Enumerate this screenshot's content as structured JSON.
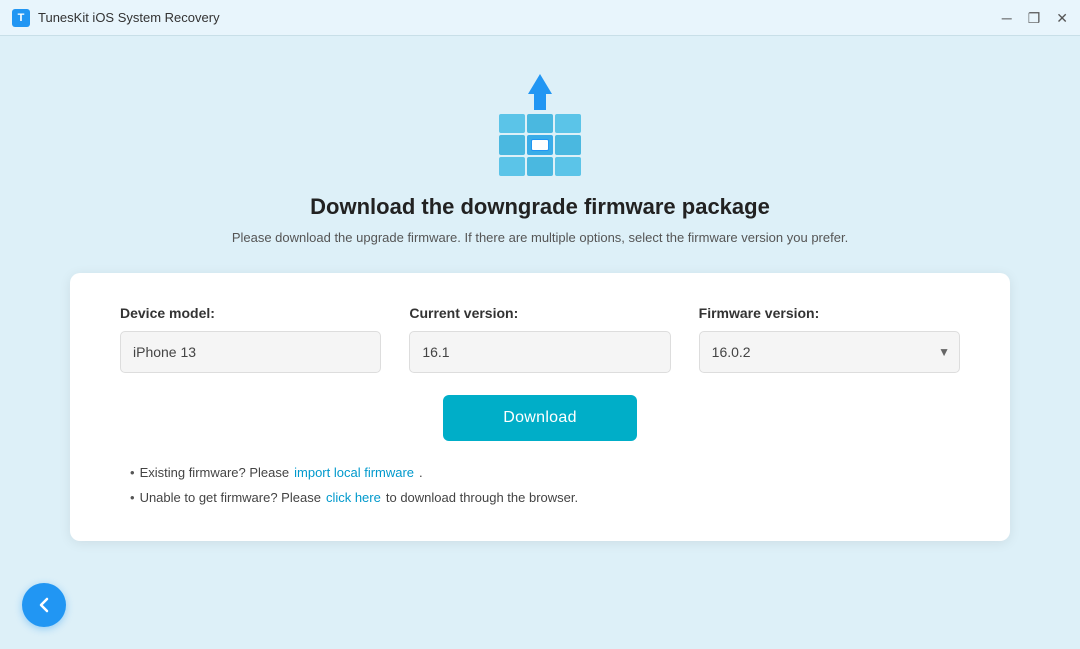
{
  "titleBar": {
    "appName": "TunesKit iOS System Recovery",
    "iconLabel": "T",
    "minimizeLabel": "─",
    "maximizeLabel": "❐",
    "closeLabel": "✕"
  },
  "header": {
    "title": "Download the downgrade firmware package",
    "subtitle": "Please download the upgrade firmware. If there are multiple options, select the firmware version you prefer."
  },
  "form": {
    "deviceModelLabel": "Device model:",
    "deviceModelValue": "iPhone 13",
    "currentVersionLabel": "Current version:",
    "currentVersionValue": "16.1",
    "firmwareVersionLabel": "Firmware version:",
    "firmwareVersionValue": "16.0.2"
  },
  "downloadButton": {
    "label": "Download"
  },
  "notes": {
    "note1Prefix": "Existing firmware? Please ",
    "note1LinkText": "import local firmware",
    "note1Suffix": ".",
    "note2Prefix": "Unable to get firmware? Please ",
    "note2LinkText": "click here",
    "note2Suffix": " to download through the browser."
  },
  "backButton": {
    "ariaLabel": "Back"
  }
}
